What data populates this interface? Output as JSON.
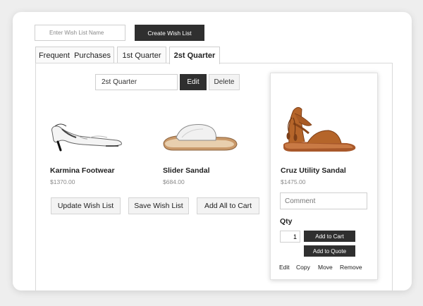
{
  "wishlist": {
    "name_placeholder": "Enter Wish List Name",
    "create_label": "Create Wish List"
  },
  "tabs": [
    {
      "label": "Frequent  Purchases"
    },
    {
      "label": "1st Quarter"
    },
    {
      "label": "2st Quarter"
    }
  ],
  "active_list": {
    "name_value": "2st Quarter",
    "edit_label": "Edit",
    "delete_label": "Delete"
  },
  "products": [
    {
      "name": "Karmina Footwear",
      "price": "$1370.00",
      "image": "white-heel-slingback"
    },
    {
      "name": "Slider Sandal",
      "price": "$684.00",
      "image": "white-slide-sandal"
    }
  ],
  "actions": {
    "update_label": "Update Wish List",
    "save_label": "Save Wish List",
    "add_all_label": "Add All to Cart"
  },
  "featured": {
    "name": "Cruz Utility Sandal",
    "price": "$1475.00",
    "image": "tan-ankle-strap-sandal",
    "comment_placeholder": "Comment",
    "qty_label": "Qty",
    "qty_value": "1",
    "add_cart_label": "Add to Cart",
    "add_quote_label": "Add to Quote",
    "links": [
      "Edit",
      "Copy",
      "Move",
      "Remove"
    ]
  },
  "colors": {
    "dark_button": "#2f2f2f",
    "sandal_tan": "#b5652a"
  }
}
